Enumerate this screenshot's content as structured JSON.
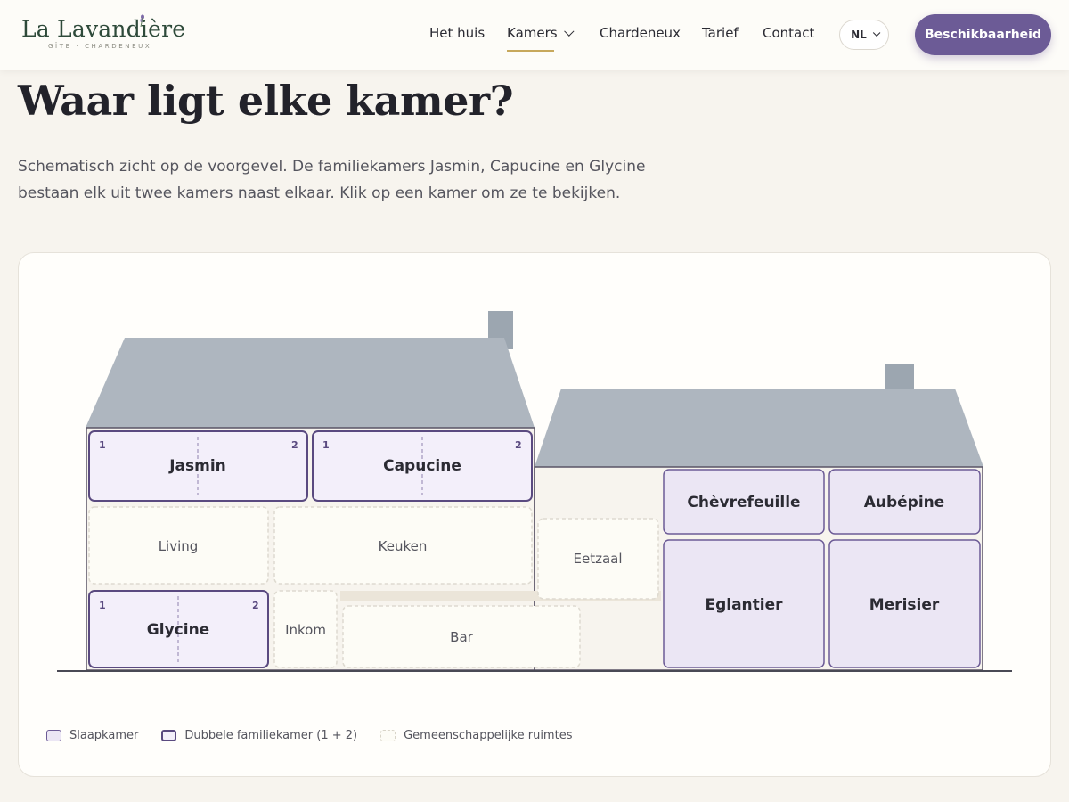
{
  "brand": {
    "name": "La Lavandière",
    "tagline": "GÎTE · CHARDENEUX"
  },
  "nav": {
    "items": [
      {
        "label": "Het huis"
      },
      {
        "label": "Kamers"
      },
      {
        "label": "Chardeneux"
      },
      {
        "label": "Tarief"
      },
      {
        "label": "Contact"
      }
    ],
    "language": "NL",
    "cta": "Beschikbaarheid"
  },
  "page": {
    "title": "Waar ligt elke kamer?",
    "intro": "Schematisch zicht op de voorgevel. De familiekamers Jasmin, Capucine en Glycine bestaan elk uit twee kamers naast elkaar. Klik op een kamer om ze te bekijken."
  },
  "rooms": {
    "jasmin": {
      "name": "Jasmin",
      "n1": "1",
      "n2": "2"
    },
    "capucine": {
      "name": "Capucine",
      "n1": "1",
      "n2": "2"
    },
    "glycine": {
      "name": "Glycine",
      "n1": "1",
      "n2": "2"
    },
    "chevrefeuille": {
      "name": "Chèvrefeuille"
    },
    "aubepine": {
      "name": "Aubépine"
    },
    "eglantier": {
      "name": "Eglantier"
    },
    "merisier": {
      "name": "Merisier"
    }
  },
  "common": {
    "living": "Living",
    "keuken": "Keuken",
    "eetzaal": "Eetzaal",
    "inkom": "Inkom",
    "bar": "Bar"
  },
  "legend": {
    "room": "Slaapkamer",
    "family": "Dubbele familiekamer (1 + 2)",
    "common": "Gemeenschappelijke ruimtes"
  },
  "colors": {
    "accent": "#6c5b96",
    "roof": "#aeb6bf",
    "chimney": "#9ca6b0",
    "room_fill": "#ebe6f4",
    "family_fill": "#f3effa",
    "wall": "#5a5566",
    "underline": "#c7a85c"
  }
}
